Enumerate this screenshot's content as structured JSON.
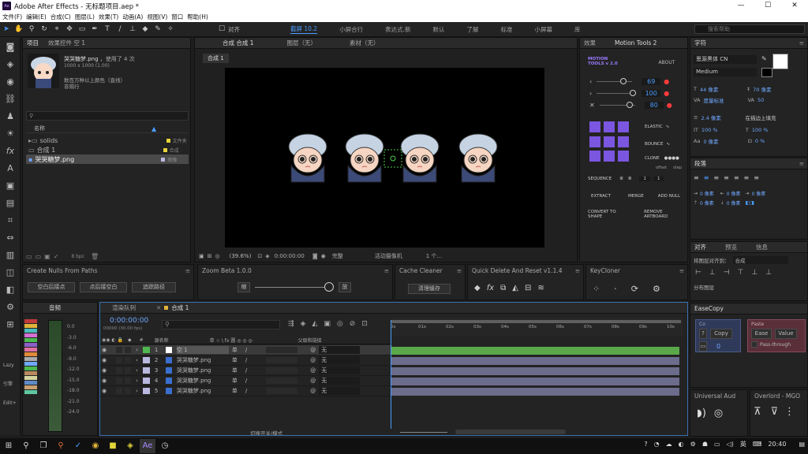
{
  "window": {
    "title": "Adobe After Effects - 无标题项目.aep *",
    "controls": [
      "—",
      "☐",
      "✕"
    ]
  },
  "menu": [
    "文件(F)",
    "编辑(E)",
    "合成(C)",
    "图层(L)",
    "效果(T)",
    "动画(A)",
    "视图(V)",
    "窗口",
    "帮助(H)"
  ],
  "toolbar": {
    "align_label": "对齐",
    "workspaces": [
      "截屏 10.2",
      "小屏合行",
      "表达式.新",
      "默认",
      "了解",
      "标准",
      "小屏幕",
      "库"
    ],
    "search_placeholder": "搜索帮助"
  },
  "project": {
    "tab": "项目",
    "effects_tab": "效果控件 空 1",
    "file_name": "哭哭糖梦.png",
    "used_count": "，使用了 4 次",
    "dims": "1000 x 1000 (1.00)",
    "color_info": "数百万种以上颜色（直线）",
    "status": "非隔行",
    "col_name": "名称",
    "items": [
      {
        "name": "solids",
        "color": "#e6d63a",
        "type": "文件夹"
      },
      {
        "name": "合成 1",
        "color": "#e6d63a",
        "type": "合成"
      },
      {
        "name": "哭哭糖梦.png",
        "color": "#b9b9e0",
        "type": "图像"
      }
    ],
    "bpc": "8 bpc"
  },
  "composition": {
    "tab": "合成 合成 1",
    "layer_tab": "图层（无）",
    "footage_tab": "素材（无）",
    "subtab": "合成 1",
    "zoom": "(39.6%)",
    "time": "0:00:00:00",
    "quality": "完整",
    "camera": "活动摄像机",
    "views": "1 个..."
  },
  "right_tools": {
    "tab": "效果",
    "motion_tab": "Motion Tools 2",
    "logo": "MOTION TOOLS v 2.0",
    "about": "ABOUT",
    "sliders": [
      "69",
      "100",
      "80"
    ],
    "elastic": "ELASTIC",
    "bounce": "BOUNCE",
    "clone": "CLONE",
    "offset": "offset",
    "step": "step",
    "sequence": "SEQUENCE",
    "seq_vals": [
      "1",
      "1"
    ],
    "extract": "EXTRACT",
    "merge": "MERGE",
    "add_null": "ADD NULL",
    "convert": "CONVERT TO SHAPE",
    "remove": "REMOVE ARTBOARD"
  },
  "character": {
    "tab": "字符",
    "font": "思源黑体 CN",
    "style": "Medium",
    "size": "44 像素",
    "leading": "70 像素",
    "tracking_label": "度量标准",
    "tracking": "50",
    "stroke": "2.4 像素",
    "stroke_mode": "在描边上填充",
    "vscale": "100 %",
    "hscale": "100 %",
    "baseline": "0 像素",
    "tsume": "0 %"
  },
  "paragraph": {
    "tab": "段落",
    "indents": [
      "0 像素",
      "0 像素",
      "0 像素",
      "0 像素",
      "0 像素"
    ]
  },
  "align": {
    "tab": "对齐",
    "tab2": "预览",
    "tab3": "信息",
    "target_label": "将图层对齐到：",
    "target": "合成",
    "distribute": "分布图层"
  },
  "mid_panels": [
    {
      "title": "Create Nulls From Paths",
      "buttons": [
        "空白后接点",
        "点后接空白",
        "追踪路径"
      ]
    },
    {
      "title": "Zoom Beta 1.0.0",
      "left": "缩",
      "right": "放"
    },
    {
      "title": "Cache Cleaner",
      "button": "清理缓存"
    },
    {
      "title": "Quick Delete And Reset v1.1.4"
    },
    {
      "title": "KeyCloner"
    }
  ],
  "audio": {
    "tab": "音频",
    "scale": [
      "0.0",
      "-3.0",
      "-6.0",
      "-9.0",
      "-12.0",
      "-15.0",
      "-18.0",
      "-21.0",
      "-24.0"
    ],
    "left_labels": [
      "Lazy",
      "引擎",
      "Edit+"
    ]
  },
  "timeline": {
    "tab_render": "渲染队列",
    "tab_comp": "合成 1",
    "timecode": "0:00:00:00",
    "fps": "00000 (30.00 fps)",
    "headers": [
      "#",
      "源名称",
      "单 ☆ \\ fx 圆 ◎ ◎ ◎",
      "父级和链接"
    ],
    "ticks": [
      "0s",
      "01s",
      "02s",
      "03s",
      "04s",
      "05s",
      "06s",
      "07s",
      "08s",
      "09s",
      "10s"
    ],
    "toggle": "切换开关/模式",
    "layers": [
      {
        "num": "1",
        "name": "空 1",
        "color": "#4fb84f",
        "parent": "无",
        "bar": "#5aa84a"
      },
      {
        "num": "2",
        "name": "哭哭糖梦.png",
        "color": "#b9b9e0",
        "parent": "无",
        "bar": "#6c6c8c"
      },
      {
        "num": "3",
        "name": "哭哭糖梦.png",
        "color": "#b9b9e0",
        "parent": "无",
        "bar": "#6c6c8c"
      },
      {
        "num": "4",
        "name": "哭哭糖梦.png",
        "color": "#b9b9e0",
        "parent": "无",
        "bar": "#6c6c8c"
      },
      {
        "num": "5",
        "name": "哭哭糖梦.png",
        "color": "#b9b9e0",
        "parent": "无",
        "bar": "#6c6c8c"
      }
    ]
  },
  "easecopy": {
    "tab": "EaseCopy",
    "co": "Co",
    "copy": "Copy",
    "paste": "Paste",
    "ease": "Ease",
    "value": "Value",
    "pass": "Pass-through",
    "zero": "0"
  },
  "bottom_right": {
    "ua": "Universal Aud",
    "overlord": "Overlord - MGO"
  },
  "taskbar": {
    "time": "20:40",
    "lang": "英"
  }
}
